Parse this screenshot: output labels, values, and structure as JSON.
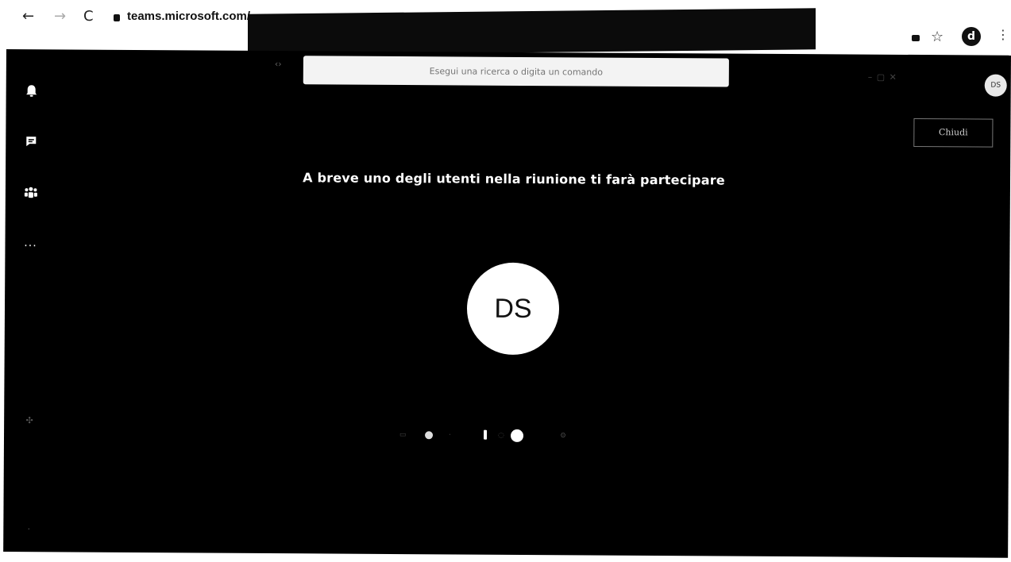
{
  "browser": {
    "back": "←",
    "forward": "→",
    "reload": "C",
    "url": "teams.microsoft.com/",
    "star": "☆",
    "profile_initial": "d",
    "menu": "⋮"
  },
  "teams": {
    "search_placeholder": "Esegui una ricerca o digita un comando",
    "avatar_initials": "DS",
    "close_label": "Chiudi",
    "wait_message": "A breve uno degli utenti nella riunione ti farà partecipare",
    "user_initials": "DS",
    "rail": {
      "activity_icon": "bell-icon",
      "chat_icon": "chat-icon",
      "teams_icon": "teams-icon",
      "more_label": "..."
    }
  }
}
